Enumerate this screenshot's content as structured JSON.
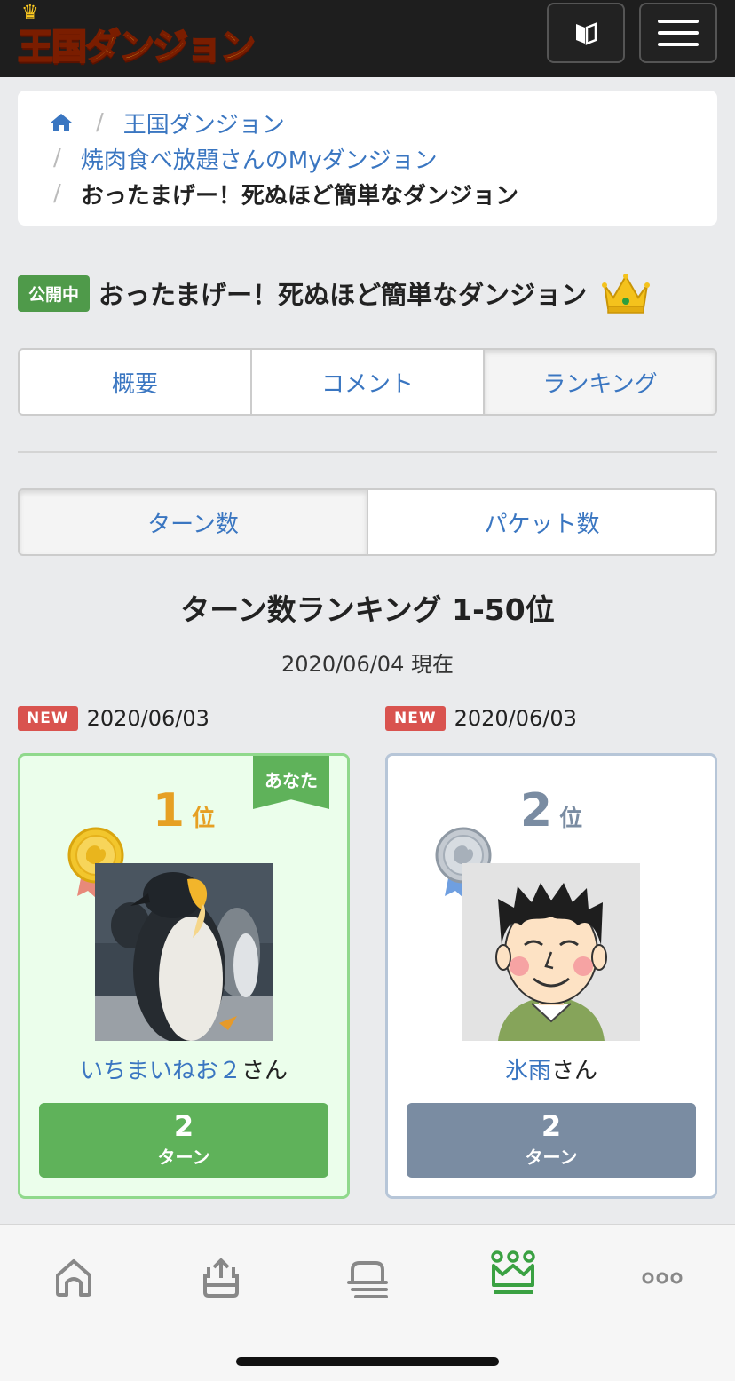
{
  "header": {
    "logo_text": "王国ダンジョン",
    "book_icon": "book-icon",
    "menu_icon": "hamburger-icon"
  },
  "breadcrumb": {
    "home_icon": "home-icon",
    "items": [
      "王国ダンジョン",
      "焼肉食べ放題さんのMyダンジョン",
      "おったまげー！死ぬほど簡単なダンジョン"
    ]
  },
  "dungeon": {
    "status_badge": "公開中",
    "title": "おったまげー！死ぬほど簡単なダンジョン",
    "crown_icon": "crown-icon"
  },
  "tabs": [
    {
      "label": "概要",
      "active": false
    },
    {
      "label": "コメント",
      "active": false
    },
    {
      "label": "ランキング",
      "active": true
    }
  ],
  "subtabs": [
    {
      "label": "ターン数",
      "active": true
    },
    {
      "label": "パケット数",
      "active": false
    }
  ],
  "ranking": {
    "title": "ターン数ランキング 1-50位",
    "as_of": "2020/06/04 現在",
    "entries": [
      {
        "new_badge": "NEW",
        "date": "2020/06/03",
        "ribbon": "あなた",
        "rank": "1",
        "rank_suffix": "位",
        "medal": "gold-medal-icon",
        "name": "いちまいねお２",
        "honorific": "さん",
        "score": "2",
        "unit": "ターン",
        "color": "#5fb25a"
      },
      {
        "new_badge": "NEW",
        "date": "2020/06/03",
        "rank": "2",
        "rank_suffix": "位",
        "medal": "silver-medal-icon",
        "name": "氷雨",
        "honorific": "さん",
        "score": "2",
        "unit": "ターン",
        "color": "#7a8ca2"
      }
    ]
  },
  "bottom_nav": {
    "items": [
      "home-icon",
      "upload-icon",
      "dungeon-list-icon",
      "ranking-crown-icon",
      "more-icon"
    ],
    "active": "ranking-crown-icon",
    "active_color": "#3aa142"
  }
}
